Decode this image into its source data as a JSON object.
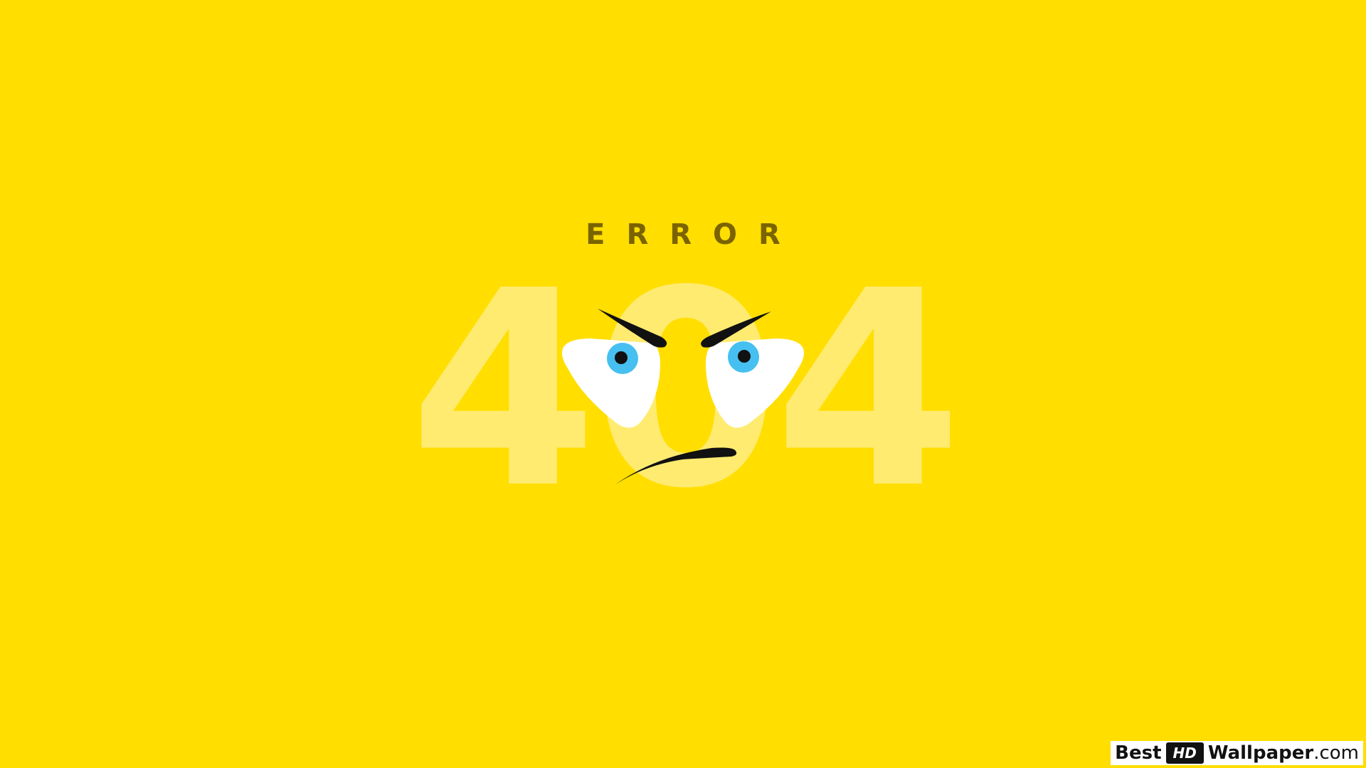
{
  "heading": {
    "error_label": "ERROR",
    "code": "404"
  },
  "colors": {
    "background": "#FFDE00",
    "error_text": "#7A6400",
    "faded_digits": "#FFEB70",
    "eye_white": "#FFFFFF",
    "iris": "#46C0F0",
    "pupil": "#111111",
    "brow_and_mouth": "#111111"
  },
  "face": {
    "expression": "angry",
    "icons": [
      "left-eyebrow-icon",
      "right-eyebrow-icon",
      "left-eye-icon",
      "right-eye-icon",
      "frown-mouth-icon"
    ]
  },
  "watermark": {
    "best": "Best",
    "hd": "HD",
    "wallpaper": "Wallpaper",
    "tld": ".com"
  }
}
